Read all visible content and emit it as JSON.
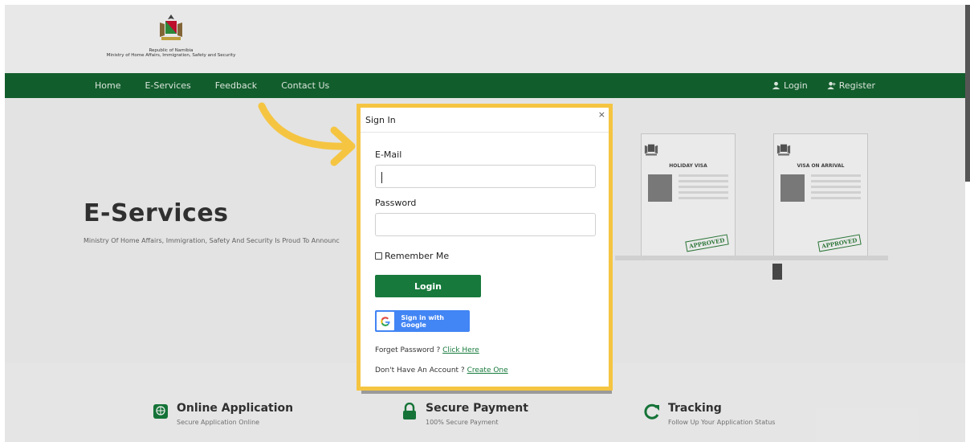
{
  "header": {
    "logo_line1": "Republic of Namibia",
    "logo_line2": "Ministry of Home Affairs, Immigration, Safety and Security"
  },
  "nav": {
    "items": [
      "Home",
      "E-Services",
      "Feedback",
      "Contact Us"
    ],
    "login": "Login",
    "register": "Register"
  },
  "hero": {
    "title": "E-Services",
    "subtitle": "Ministry Of Home Affairs, Immigration, Safety And Security Is Proud To Announc",
    "visa_cards": [
      {
        "title": "HOLIDAY VISA",
        "stamp": "APPROVED"
      },
      {
        "title": "VISA ON ARRIVAL",
        "stamp": "APPROVED"
      }
    ]
  },
  "features": [
    {
      "title": "Online Application",
      "subtitle": "Secure Application Online",
      "icon": "globe-icon"
    },
    {
      "title": "Secure Payment",
      "subtitle": "100% Secure Payment",
      "icon": "lock-icon"
    },
    {
      "title": "Tracking",
      "subtitle": "Follow Up Your Application Status",
      "icon": "refresh-icon"
    }
  ],
  "modal": {
    "title": "Sign In",
    "close": "×",
    "email_label": "E-Mail",
    "email_value": "",
    "password_label": "Password",
    "password_value": "",
    "remember_label": "Remember Me",
    "login_button": "Login",
    "google_button": "Sign in with Google",
    "forget_text": "Forget Password ? ",
    "forget_link": "Click Here",
    "account_text": "Don't Have An Account ? ",
    "account_link": "Create One"
  },
  "colors": {
    "nav_green": "#14622f",
    "button_green": "#177a3c",
    "highlight_yellow": "#f5c542",
    "google_blue": "#4285f4"
  }
}
